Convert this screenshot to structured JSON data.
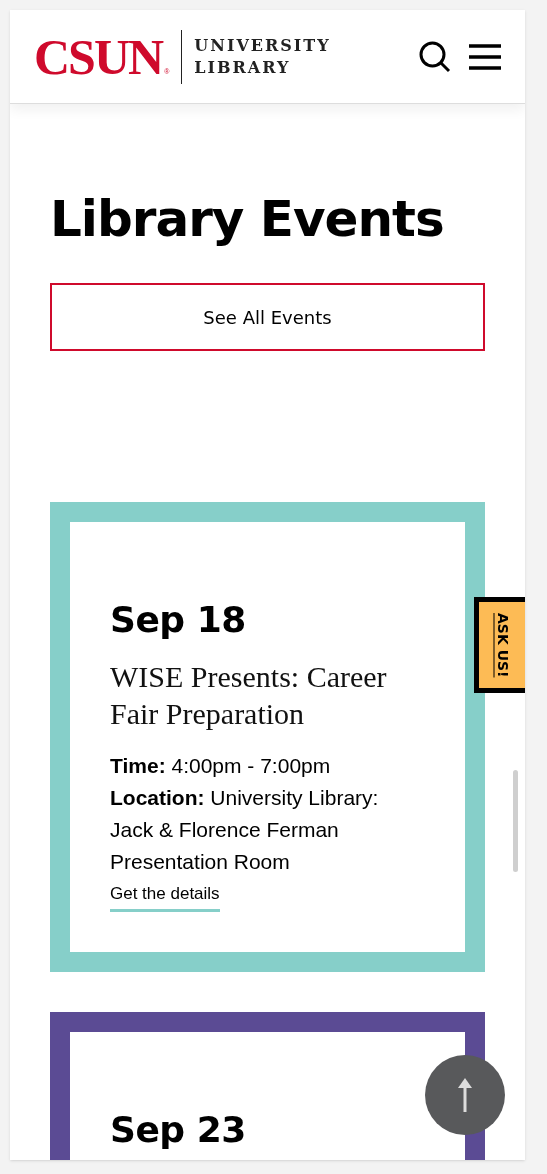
{
  "header": {
    "logo": {
      "wordmark": "CSUN",
      "registered": "®",
      "line_1": "UNIVERSITY",
      "line_2": "LIBRARY"
    }
  },
  "page_title": "Library Events",
  "see_all_button": "See All Events",
  "events": [
    {
      "date": "Sep 18",
      "title": "WISE Presents: Career Fair Preparation",
      "time_label": "Time:",
      "time": "4:00pm - 7:00pm",
      "location_label": "Location:",
      "location": "University Library: Jack & Florence Ferman Presentation Room",
      "link": "Get the details",
      "color": "#86cfc9"
    },
    {
      "date": "Sep 23",
      "color": "#5b4b94"
    }
  ],
  "ask_us": "ASK US!"
}
